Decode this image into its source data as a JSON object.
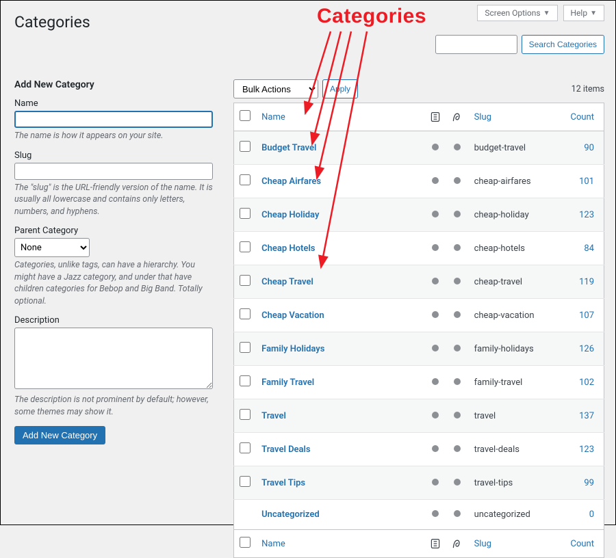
{
  "top_tabs": {
    "screen_options": "Screen Options",
    "help": "Help"
  },
  "page_title": "Categories",
  "search": {
    "button": "Search Categories"
  },
  "items_count": "12 items",
  "bulk": {
    "label": "Bulk Actions",
    "apply": "Apply"
  },
  "columns": {
    "name": "Name",
    "slug": "Slug",
    "count": "Count"
  },
  "annotation": "Categories",
  "add_form": {
    "heading": "Add New Category",
    "name_label": "Name",
    "name_help": "The name is how it appears on your site.",
    "slug_label": "Slug",
    "slug_help": "The \"slug\" is the URL-friendly version of the name. It is usually all lowercase and contains only letters, numbers, and hyphens.",
    "parent_label": "Parent Category",
    "parent_value": "None",
    "parent_help": "Categories, unlike tags, can have a hierarchy. You might have a Jazz category, and under that have children categories for Bebop and Big Band. Totally optional.",
    "desc_label": "Description",
    "desc_help": "The description is not prominent by default; however, some themes may show it.",
    "submit": "Add New Category"
  },
  "rows": [
    {
      "name": "Budget Travel",
      "slug": "budget-travel",
      "count": "90",
      "cb": true
    },
    {
      "name": "Cheap Airfares",
      "slug": "cheap-airfares",
      "count": "101",
      "cb": true
    },
    {
      "name": "Cheap Holiday",
      "slug": "cheap-holiday",
      "count": "123",
      "cb": true
    },
    {
      "name": "Cheap Hotels",
      "slug": "cheap-hotels",
      "count": "84",
      "cb": true
    },
    {
      "name": "Cheap Travel",
      "slug": "cheap-travel",
      "count": "119",
      "cb": true
    },
    {
      "name": "Cheap Vacation",
      "slug": "cheap-vacation",
      "count": "107",
      "cb": true
    },
    {
      "name": "Family Holidays",
      "slug": "family-holidays",
      "count": "126",
      "cb": true
    },
    {
      "name": "Family Travel",
      "slug": "family-travel",
      "count": "102",
      "cb": true
    },
    {
      "name": "Travel",
      "slug": "travel",
      "count": "137",
      "cb": true
    },
    {
      "name": "Travel Deals",
      "slug": "travel-deals",
      "count": "123",
      "cb": true
    },
    {
      "name": "Travel Tips",
      "slug": "travel-tips",
      "count": "99",
      "cb": true
    },
    {
      "name": "Uncategorized",
      "slug": "uncategorized",
      "count": "0",
      "cb": false
    }
  ]
}
